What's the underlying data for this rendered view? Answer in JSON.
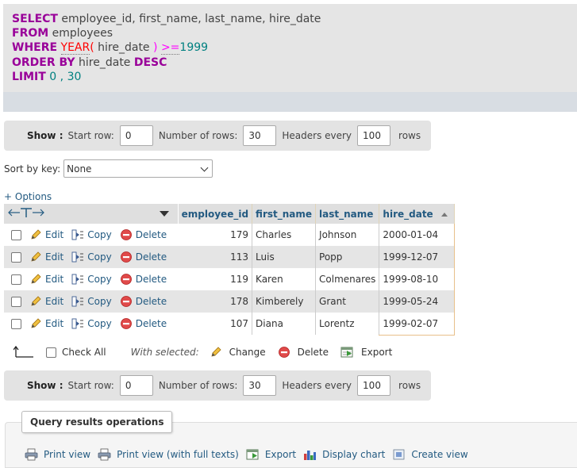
{
  "sql": {
    "line1": {
      "kw": "SELECT",
      "rest": " employee_id, first_name, last_name, hire_date"
    },
    "line2": {
      "kw": "FROM",
      "rest": " employees"
    },
    "line3": {
      "kw": "WHERE",
      "fn": "YEAR",
      "open": "( ",
      "col": "hire_date",
      "close": " )",
      "op": ">=",
      "num": "1999"
    },
    "line4": {
      "kw": "ORDER BY",
      "rest": " hire_date ",
      "kw2": "DESC"
    },
    "line5": {
      "kw": "LIMIT",
      "n1": "0",
      "sep": " , ",
      "n2": "30"
    }
  },
  "nav": {
    "show_label": "Show :",
    "start_row_label": "Start row:",
    "start_row_value": "0",
    "num_rows_label": "Number of rows:",
    "num_rows_value": "30",
    "headers_every_label": "Headers every",
    "headers_every_value": "100",
    "rows_label": "rows"
  },
  "sort": {
    "label": "Sort by key:",
    "selected": "None"
  },
  "options_link": "+ Options",
  "table": {
    "columns": [
      "employee_id",
      "first_name",
      "last_name",
      "hire_date"
    ],
    "actions": {
      "edit": "Edit",
      "copy": "Copy",
      "delete": "Delete"
    },
    "rows": [
      {
        "employee_id": "179",
        "first_name": "Charles",
        "last_name": "Johnson",
        "hire_date": "2000-01-04"
      },
      {
        "employee_id": "113",
        "first_name": "Luis",
        "last_name": "Popp",
        "hire_date": "1999-12-07"
      },
      {
        "employee_id": "119",
        "first_name": "Karen",
        "last_name": "Colmenares",
        "hire_date": "1999-08-10"
      },
      {
        "employee_id": "178",
        "first_name": "Kimberely",
        "last_name": "Grant",
        "hire_date": "1999-05-24"
      },
      {
        "employee_id": "107",
        "first_name": "Diana",
        "last_name": "Lorentz",
        "hire_date": "1999-02-07"
      }
    ]
  },
  "with_selected": {
    "check_all": "Check All",
    "label": "With selected:",
    "change": "Change",
    "delete": "Delete",
    "export": "Export"
  },
  "query_ops": {
    "title": "Query results operations",
    "links": [
      "Print view",
      "Print view (with full texts)",
      "Export",
      "Display chart",
      "Create view"
    ]
  },
  "colors": {
    "link": "#235a81",
    "keyword": "#990099",
    "function": "#ff0000",
    "number": "#008080"
  }
}
